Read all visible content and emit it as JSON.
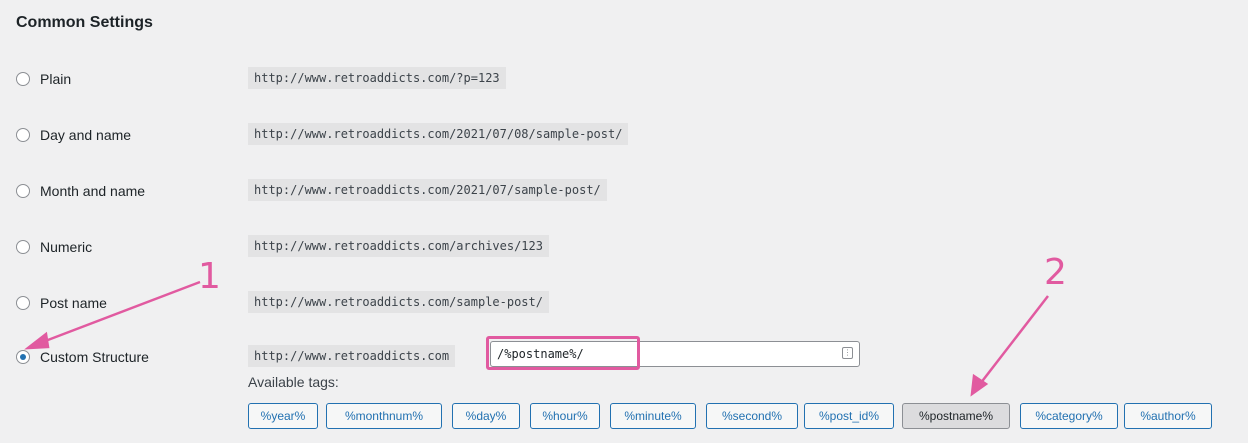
{
  "section_title": "Common Settings",
  "options": [
    {
      "label": "Plain",
      "example": "http://www.retroaddicts.com/?p=123",
      "checked": false
    },
    {
      "label": "Day and name",
      "example": "http://www.retroaddicts.com/2021/07/08/sample-post/",
      "checked": false
    },
    {
      "label": "Month and name",
      "example": "http://www.retroaddicts.com/2021/07/sample-post/",
      "checked": false
    },
    {
      "label": "Numeric",
      "example": "http://www.retroaddicts.com/archives/123",
      "checked": false
    },
    {
      "label": "Post name",
      "example": "http://www.retroaddicts.com/sample-post/",
      "checked": false
    },
    {
      "label": "Custom Structure",
      "example": "http://www.retroaddicts.com",
      "checked": true
    }
  ],
  "custom_structure": {
    "value": "/%postname%/"
  },
  "available_tags_label": "Available tags:",
  "tags": [
    {
      "label": "%year%",
      "active": false
    },
    {
      "label": "%monthnum%",
      "active": false
    },
    {
      "label": "%day%",
      "active": false
    },
    {
      "label": "%hour%",
      "active": false
    },
    {
      "label": "%minute%",
      "active": false
    },
    {
      "label": "%second%",
      "active": false
    },
    {
      "label": "%post_id%",
      "active": false
    },
    {
      "label": "%postname%",
      "active": true
    },
    {
      "label": "%category%",
      "active": false
    },
    {
      "label": "%author%",
      "active": false
    }
  ],
  "annotations": [
    "1",
    "2"
  ],
  "colors": {
    "accent": "#2271b1",
    "annotation": "#e15aa0",
    "background": "#f0f0f1"
  }
}
